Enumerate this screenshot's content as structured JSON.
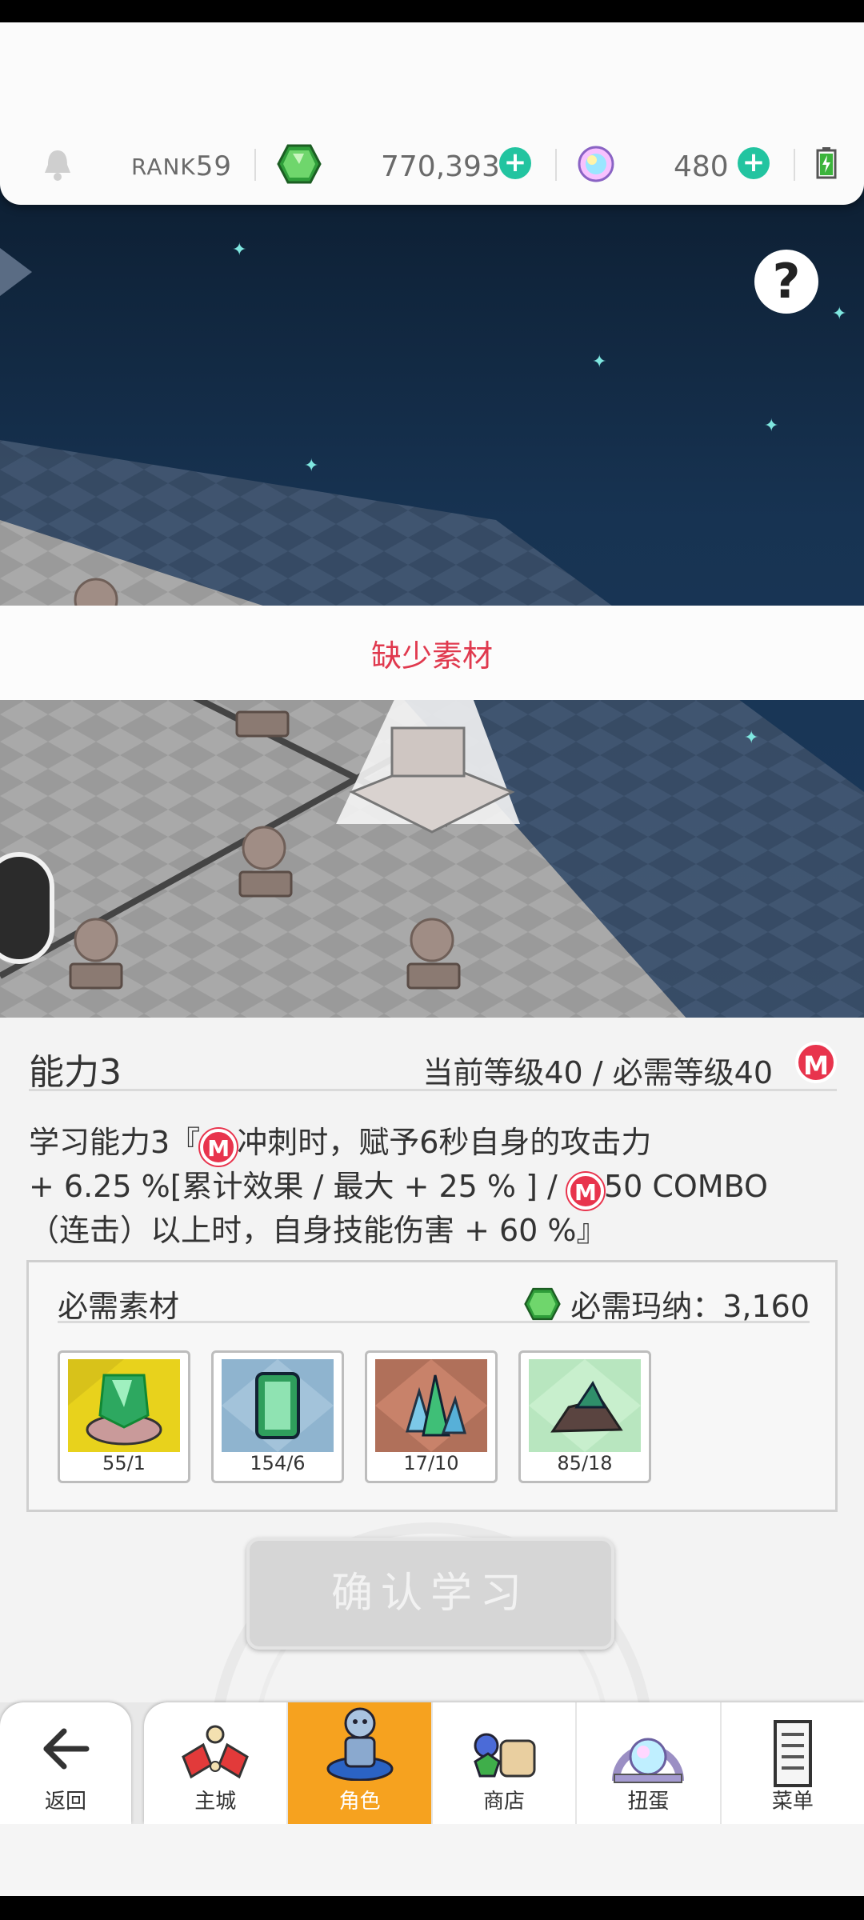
{
  "header": {
    "rank_label": "RANK",
    "rank_value": "59",
    "mana_value": "770,393",
    "orb_value": "480"
  },
  "scene": {
    "help_label": "?"
  },
  "banner": {
    "text": "缺少素材"
  },
  "ability": {
    "name": "能力3",
    "level_info": "当前等级40 / 必需等级40",
    "badge_letter": "M",
    "desc_line1_a": "学习能力3『",
    "desc_line1_b": "冲刺时，赋予6秒自身的攻击力",
    "desc_line2_a": "+ 6.25 %[累计效果 / 最大 + 25 % ] /",
    "desc_line2_b": "50 COMBO",
    "desc_line3": "（连击）以上时，自身技能伤害 + 60 %』"
  },
  "materials": {
    "title": "必需素材",
    "mana_required": "必需玛纳：3,160",
    "items": [
      {
        "count": "55/1"
      },
      {
        "count": "154/6"
      },
      {
        "count": "17/10"
      },
      {
        "count": "85/18"
      }
    ]
  },
  "confirm_button": "确认学习",
  "nav": {
    "back": "返回",
    "tabs": [
      {
        "label": "主城"
      },
      {
        "label": "角色"
      },
      {
        "label": "商店"
      },
      {
        "label": "扭蛋"
      },
      {
        "label": "菜单"
      }
    ]
  },
  "colors": {
    "accent_red": "#e0394e",
    "active_tab": "#f6a21f",
    "plus_green": "#22c4a0"
  }
}
